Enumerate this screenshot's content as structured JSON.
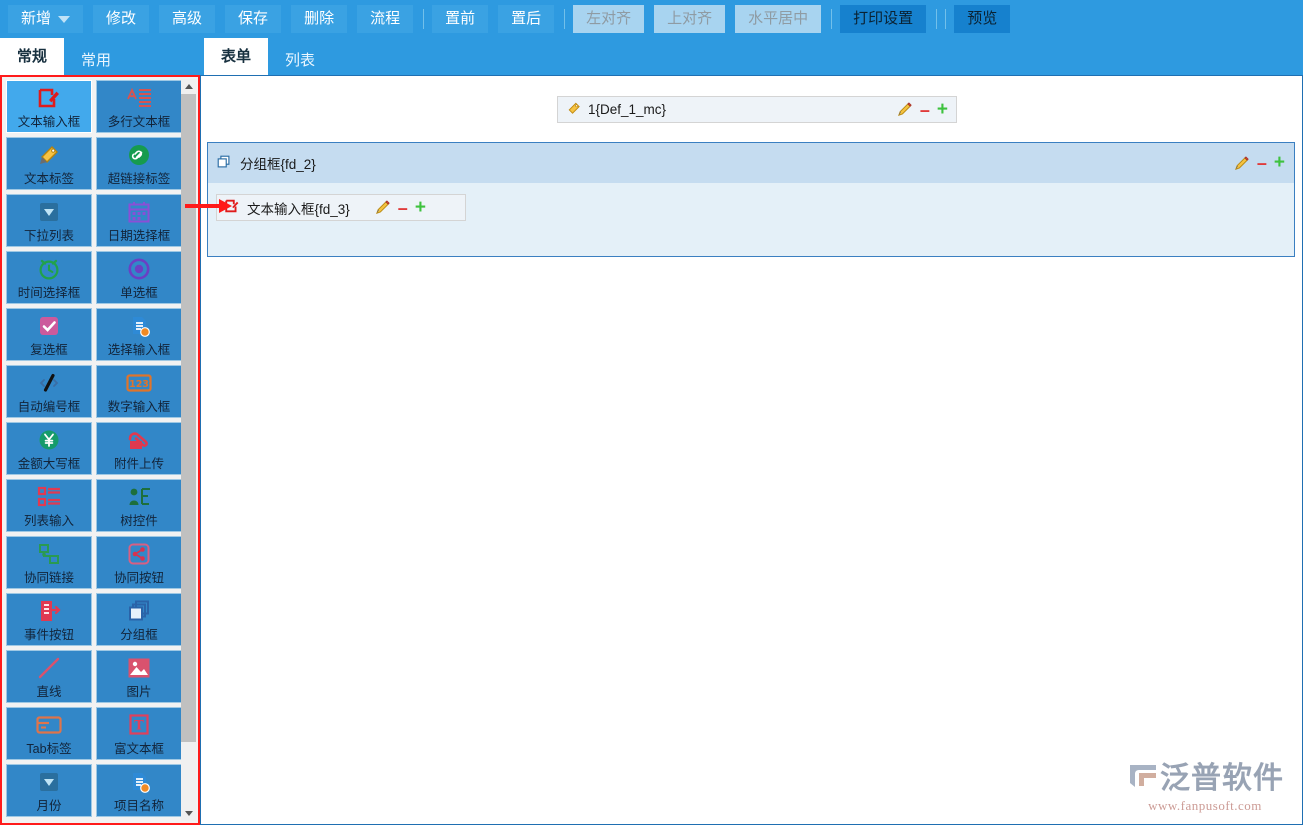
{
  "toolbar": {
    "buttons": [
      {
        "label": "新增",
        "style": "normal",
        "icon": "chevron-down-icon",
        "dropdown": true
      },
      {
        "label": "修改",
        "style": "normal"
      },
      {
        "label": "高级",
        "style": "normal"
      },
      {
        "label": "保存",
        "style": "normal"
      },
      {
        "label": "删除",
        "style": "normal"
      },
      {
        "label": "流程",
        "style": "normal"
      },
      {
        "label": "|",
        "style": "separator"
      },
      {
        "label": "置前",
        "style": "normal"
      },
      {
        "label": "置后",
        "style": "normal"
      },
      {
        "label": "|",
        "style": "separator"
      },
      {
        "label": "左对齐",
        "style": "disabled"
      },
      {
        "label": "上对齐",
        "style": "disabled"
      },
      {
        "label": "水平居中",
        "style": "disabled"
      },
      {
        "label": "|",
        "style": "separator"
      },
      {
        "label": "打印设置",
        "style": "dark"
      },
      {
        "label": "|",
        "style": "separator"
      },
      {
        "label": "|",
        "style": "separator"
      },
      {
        "label": "预览",
        "style": "dark"
      }
    ]
  },
  "left_panel": {
    "tabs": [
      {
        "label": "常规",
        "active": true
      },
      {
        "label": "常用",
        "active": false
      }
    ],
    "palette_items": [
      {
        "label": "文本输入框",
        "icon": "text-input-icon",
        "selected": true
      },
      {
        "label": "多行文本框",
        "icon": "multiline-text-icon",
        "selected": false
      },
      {
        "label": "文本标签",
        "icon": "tag-label-icon",
        "selected": false
      },
      {
        "label": "超链接标签",
        "icon": "hyperlink-icon",
        "selected": false
      },
      {
        "label": "下拉列表",
        "icon": "dropdown-icon",
        "selected": false
      },
      {
        "label": "日期选择框",
        "icon": "calendar-icon",
        "selected": false
      },
      {
        "label": "时间选择框",
        "icon": "clock-icon",
        "selected": false
      },
      {
        "label": "单选框",
        "icon": "radio-button-icon",
        "selected": false
      },
      {
        "label": "复选框",
        "icon": "checkbox-icon",
        "selected": false
      },
      {
        "label": "选择输入框",
        "icon": "select-input-icon",
        "selected": false
      },
      {
        "label": "自动编号框",
        "icon": "auto-number-icon",
        "selected": false
      },
      {
        "label": "数字输入框",
        "icon": "number-input-icon",
        "selected": false
      },
      {
        "label": "金额大写框",
        "icon": "currency-icon",
        "selected": false
      },
      {
        "label": "附件上传",
        "icon": "upload-icon",
        "selected": false
      },
      {
        "label": "列表输入",
        "icon": "list-input-icon",
        "selected": false
      },
      {
        "label": "树控件",
        "icon": "tree-control-icon",
        "selected": false
      },
      {
        "label": "协同链接",
        "icon": "link-node-icon",
        "selected": false
      },
      {
        "label": "协同按钮",
        "icon": "share-button-icon",
        "selected": false
      },
      {
        "label": "事件按钮",
        "icon": "event-button-icon",
        "selected": false
      },
      {
        "label": "分组框",
        "icon": "group-box-icon",
        "selected": false
      },
      {
        "label": "直线",
        "icon": "line-icon",
        "selected": false
      },
      {
        "label": "图片",
        "icon": "image-icon",
        "selected": false
      },
      {
        "label": "Tab标签",
        "icon": "tab-label-icon",
        "selected": false
      },
      {
        "label": "富文本框",
        "icon": "rich-text-icon",
        "selected": false
      },
      {
        "label": "月份",
        "icon": "month-dropdown-icon",
        "selected": false
      },
      {
        "label": "项目名称",
        "icon": "project-name-icon",
        "selected": false
      }
    ],
    "scrollbar": {
      "up_icon": "scroll-up-arrow-icon",
      "down_icon": "scroll-down-arrow-icon"
    }
  },
  "right_panel": {
    "tabs": [
      {
        "label": "表单",
        "active": true
      },
      {
        "label": "列表",
        "active": false
      }
    ],
    "top_field": {
      "icon": "tag-label-icon",
      "label": "1{Def_1_mc}",
      "actions": [
        {
          "name": "edit-icon",
          "glyph": "✎"
        },
        {
          "name": "remove-icon",
          "glyph": "–"
        },
        {
          "name": "add-icon",
          "glyph": "+"
        }
      ]
    },
    "group_box": {
      "icon": "group-box-icon",
      "label": "分组框{fd_2}",
      "actions": [
        {
          "name": "edit-icon",
          "glyph": "✎"
        },
        {
          "name": "remove-icon",
          "glyph": "–"
        },
        {
          "name": "add-icon",
          "glyph": "+"
        }
      ],
      "child_field": {
        "icon": "text-input-icon",
        "label": "文本输入框{fd_3}",
        "actions": [
          {
            "name": "edit-icon",
            "glyph": "✎"
          },
          {
            "name": "remove-icon",
            "glyph": "–"
          },
          {
            "name": "add-icon",
            "glyph": "+"
          }
        ]
      }
    }
  },
  "annotation": {
    "arrow_name": "red-pointer-arrow",
    "highlight_name": "red-highlight-box"
  },
  "branding": {
    "name": "泛普软件",
    "url": "www.fanpusoft.com"
  },
  "colors": {
    "toolbar_bg": "#2e9ae0",
    "button_bg": "#3aa2e3",
    "button_dark": "#1681ce",
    "button_disabled": "#a8d4f0",
    "palette_item": "#3287c8",
    "palette_selected": "#42a9ec",
    "annotation_red": "#ff1a1a",
    "group_header": "#c5dcf0",
    "group_body": "#e4f0f8",
    "field_bg": "#eef3f8"
  }
}
